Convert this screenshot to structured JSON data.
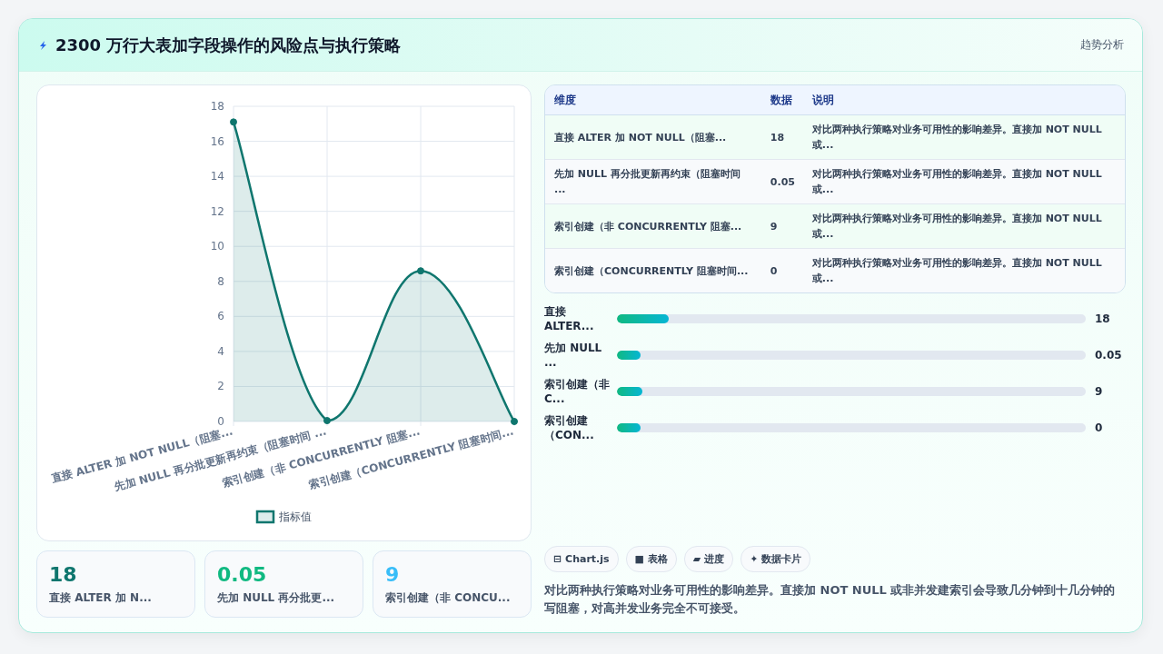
{
  "header": {
    "title": "2300 万行大表加字段操作的风险点与执行策略",
    "badge": "趋势分析"
  },
  "chart": {
    "chart_data": {
      "type": "area",
      "categories": [
        "直接 ALTER 加 NOT NULL（阻塞...",
        "先加 NULL 再分批更新再约束（阻塞时间 ...",
        "索引创建（非 CONCURRENTLY 阻塞...",
        "索引创建（CONCURRENTLY 阻塞时间..."
      ],
      "series": [
        {
          "name": "指标值",
          "color": "#0f766e",
          "values": [
            17.1,
            0.05,
            8.6,
            0
          ]
        }
      ],
      "grid": true,
      "ylim": [
        0,
        18
      ],
      "yticks": [
        0,
        2,
        4,
        6,
        8,
        10,
        12,
        14,
        16,
        18
      ]
    }
  },
  "stats": [
    {
      "value": "18",
      "label": "直接 ALTER 加 N...",
      "color": "#0f766e"
    },
    {
      "value": "0.05",
      "label": "先加 NULL 再分批更...",
      "color": "#10b981"
    },
    {
      "value": "9",
      "label": "索引创建（非 CONCU...",
      "color": "#38bdf8"
    }
  ],
  "table": {
    "columns": [
      "维度",
      "数据",
      "说明"
    ],
    "rows": [
      [
        "直接 ALTER 加 NOT NULL（阻塞...",
        "18",
        "对比两种执行策略对业务可用性的影响差异。直接加 NOT NULL 或..."
      ],
      [
        "先加 NULL 再分批更新再约束（阻塞时间 ...",
        "0.05",
        "对比两种执行策略对业务可用性的影响差异。直接加 NOT NULL 或..."
      ],
      [
        "索引创建（非 CONCURRENTLY 阻塞...",
        "9",
        "对比两种执行策略对业务可用性的影响差异。直接加 NOT NULL 或..."
      ],
      [
        "索引创建（CONCURRENTLY 阻塞时间...",
        "0",
        "对比两种执行策略对业务可用性的影响差异。直接加 NOT NULL 或..."
      ]
    ]
  },
  "progress": [
    {
      "label": "直接 ALTER...",
      "value": "18",
      "level": 0.11
    },
    {
      "label": "先加 NULL ...",
      "value": "0.05",
      "level": 0.05
    },
    {
      "label": "索引创建（非 C...",
      "value": "9",
      "level": 0.055
    },
    {
      "label": "索引创建（CON...",
      "value": "0",
      "level": 0.05
    }
  ],
  "chips": [
    {
      "icon": "⊟",
      "label": "Chart.js"
    },
    {
      "icon": "■",
      "label": "表格"
    },
    {
      "icon": "▰",
      "label": "进度"
    },
    {
      "icon": "✦",
      "label": "数据卡片"
    }
  ],
  "description": "对比两种执行策略对业务可用性的影响差异。直接加 NOT NULL 或非并发建索引会导致几分钟到十几分钟的写阻塞，对高并发业务完全不可接受。"
}
